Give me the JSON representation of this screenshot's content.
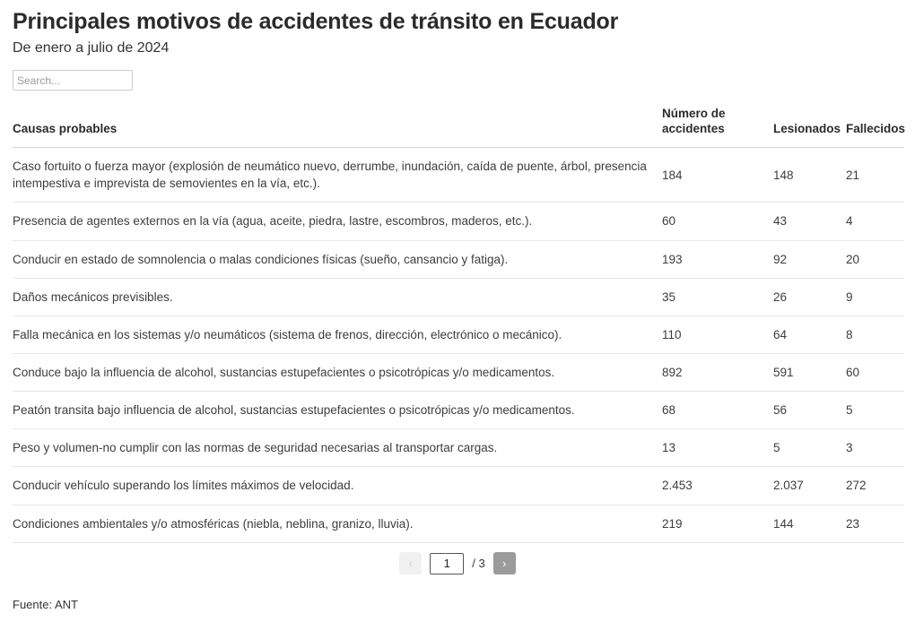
{
  "header": {
    "title": "Principales motivos de accidentes de tránsito en Ecuador",
    "subtitle": "De enero a julio de 2024"
  },
  "search": {
    "placeholder": "Search...",
    "value": ""
  },
  "table": {
    "columns": [
      "Causas probables",
      "Número de accidentes",
      "Lesionados",
      "Fallecidos"
    ],
    "rows": [
      {
        "cause": "Caso fortuito o fuerza mayor (explosión de neumático nuevo, derrumbe, inundación, caída de puente, árbol, presencia intempestiva e imprevista de semovientes en la vía, etc.).",
        "accidentes": "184",
        "lesionados": "148",
        "fallecidos": "21"
      },
      {
        "cause": "Presencia de agentes externos en la vía (agua, aceite, piedra, lastre, escombros, maderos, etc.).",
        "accidentes": "60",
        "lesionados": "43",
        "fallecidos": "4"
      },
      {
        "cause": "Conducir en estado de somnolencia o malas condiciones físicas (sueño, cansancio y fatiga).",
        "accidentes": "193",
        "lesionados": "92",
        "fallecidos": "20"
      },
      {
        "cause": "Daños mecánicos previsibles.",
        "accidentes": "35",
        "lesionados": "26",
        "fallecidos": "9"
      },
      {
        "cause": "Falla mecánica en los sistemas y/o neumáticos (sistema de frenos, dirección, electrónico o mecánico).",
        "accidentes": "110",
        "lesionados": "64",
        "fallecidos": "8"
      },
      {
        "cause": "Conduce bajo la influencia de alcohol, sustancias estupefacientes o psicotrópicas y/o medicamentos.",
        "accidentes": "892",
        "lesionados": "591",
        "fallecidos": "60"
      },
      {
        "cause": "Peatón transita bajo influencia de alcohol, sustancias estupefacientes o psicotrópicas y/o medicamentos.",
        "accidentes": "68",
        "lesionados": "56",
        "fallecidos": "5"
      },
      {
        "cause": "Peso y volumen-no cumplir con las normas de seguridad necesarias al transportar cargas.",
        "accidentes": "13",
        "lesionados": "5",
        "fallecidos": "3"
      },
      {
        "cause": "Conducir vehículo superando los límites máximos de velocidad.",
        "accidentes": "2.453",
        "lesionados": "2.037",
        "fallecidos": "272"
      },
      {
        "cause": "Condiciones ambientales y/o atmosféricas (niebla, neblina, granizo, lluvia).",
        "accidentes": "219",
        "lesionados": "144",
        "fallecidos": "23"
      }
    ]
  },
  "pagination": {
    "prev_label": "‹",
    "next_label": "›",
    "current_page": "1",
    "total_label": "/ 3"
  },
  "footer": {
    "source": "Fuente: ANT"
  }
}
